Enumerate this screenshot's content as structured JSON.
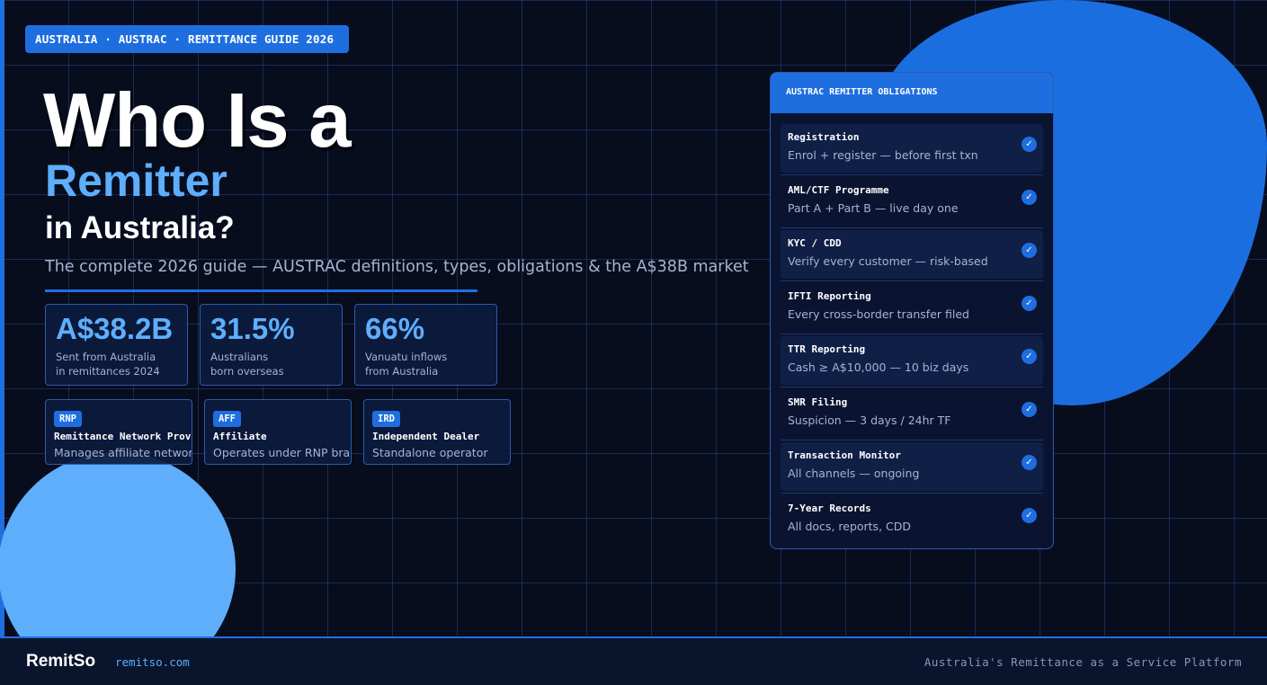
{
  "tag": "AUSTRALIA · AUSTRAC · REMITTANCE GUIDE 2026",
  "title": {
    "line1": "Who Is a",
    "line2": "Remitter",
    "line3": "in Australia?"
  },
  "subtitle": "The complete 2026 guide — AUSTRAC definitions, types, obligations & the A$38B market",
  "stats": [
    {
      "value": "A$38.2B",
      "label1": "Sent from Australia",
      "label2": "in remittances 2024"
    },
    {
      "value": "31.5%",
      "label1": "Australians",
      "label2": "born overseas"
    },
    {
      "value": "66%",
      "label1": "Vanuatu inflows",
      "label2": "from Australia"
    }
  ],
  "types": [
    {
      "badge": "RNP",
      "name": "Remittance Network Provider",
      "desc": "Manages affiliate network"
    },
    {
      "badge": "AFF",
      "name": "Affiliate",
      "desc": "Operates under RNP brand"
    },
    {
      "badge": "IRD",
      "name": "Independent Dealer",
      "desc": "Standalone operator"
    }
  ],
  "panel": {
    "title": "AUSTRAC REMITTER OBLIGATIONS",
    "check_icon": "check-circle-icon",
    "items": [
      {
        "title": "Registration",
        "desc": "Enrol + register — before first txn"
      },
      {
        "title": "AML/CTF Programme",
        "desc": "Part A + Part B — live day one"
      },
      {
        "title": "KYC / CDD",
        "desc": "Verify every customer — risk-based"
      },
      {
        "title": "IFTI Reporting",
        "desc": "Every cross-border transfer filed"
      },
      {
        "title": "TTR Reporting",
        "desc": "Cash ≥ A$10,000 — 10 biz days"
      },
      {
        "title": "SMR Filing",
        "desc": "Suspicion — 3 days / 24hr TF"
      },
      {
        "title": "Transaction Monitor",
        "desc": "All channels — ongoing"
      },
      {
        "title": "7-Year Records",
        "desc": "All docs, reports, CDD"
      }
    ]
  },
  "footer": {
    "brand": "RemitSo",
    "domain": "remitso.com",
    "tagline": "Australia's Remittance as a Service Platform"
  },
  "colors": {
    "background": "#070d1d",
    "accent": "#1e6ee0",
    "light_accent": "#5eaefc",
    "muted_text": "#a7b4d0"
  }
}
